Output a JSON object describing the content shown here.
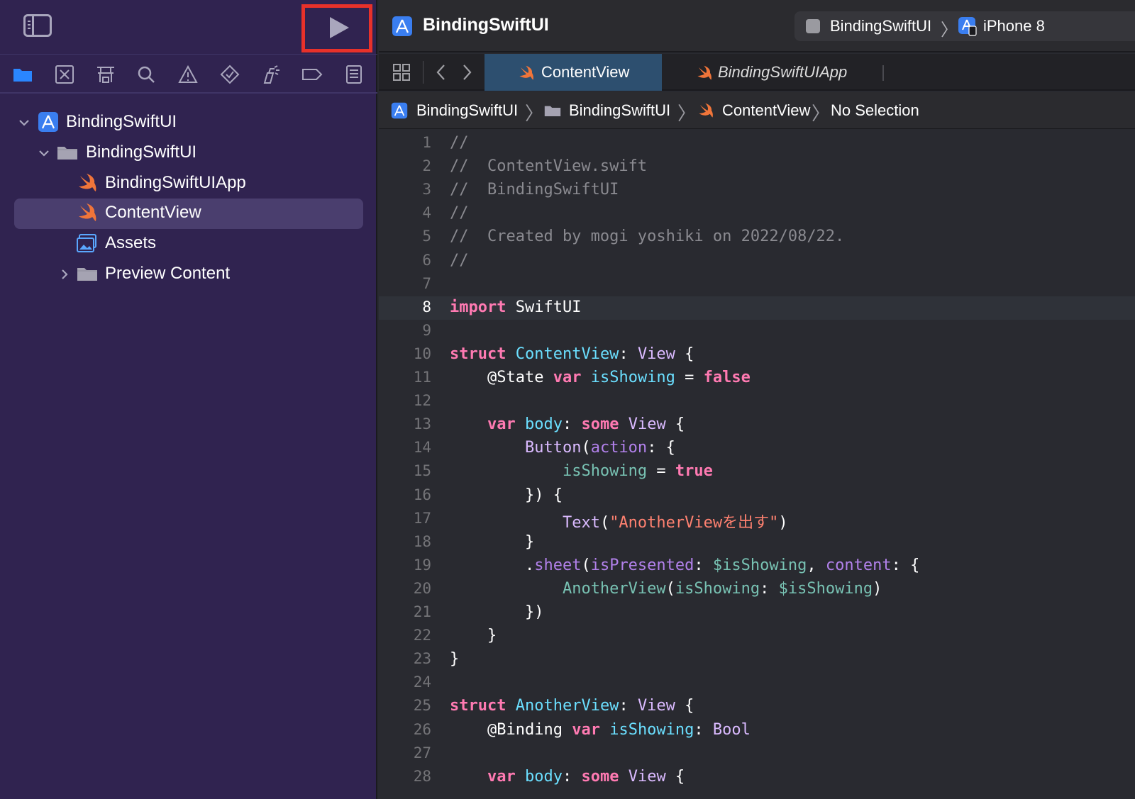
{
  "window": {
    "project_title": "BindingSwiftUI"
  },
  "scheme": {
    "target": "BindingSwiftUI",
    "device": "iPhone 8"
  },
  "tabs": [
    {
      "label": "ContentView",
      "active": true
    },
    {
      "label": "BindingSwiftUIApp",
      "active": false
    }
  ],
  "breadcrumb": [
    "BindingSwiftUI",
    "BindingSwiftUI",
    "ContentView",
    "No Selection"
  ],
  "navigator": {
    "items": [
      {
        "label": "BindingSwiftUI",
        "kind": "project",
        "expanded": true
      },
      {
        "label": "BindingSwiftUI",
        "kind": "folder",
        "expanded": true
      },
      {
        "label": "BindingSwiftUIApp",
        "kind": "swift-file"
      },
      {
        "label": "ContentView",
        "kind": "swift-file",
        "selected": true
      },
      {
        "label": "Assets",
        "kind": "asset-catalog"
      },
      {
        "label": "Preview Content",
        "kind": "folder",
        "expanded": false
      }
    ]
  },
  "editor": {
    "current_line": 8,
    "lines": [
      [
        [
          "//",
          "c-com"
        ]
      ],
      [
        [
          "//  ContentView.swift",
          "c-com"
        ]
      ],
      [
        [
          "//  BindingSwiftUI",
          "c-com"
        ]
      ],
      [
        [
          "//",
          "c-com"
        ]
      ],
      [
        [
          "//  Created by mogi yoshiki on 2022/08/22.",
          "c-com"
        ]
      ],
      [
        [
          "//",
          "c-com"
        ]
      ],
      [],
      [
        [
          "import",
          "c-kw"
        ],
        [
          " SwiftUI",
          "c-plain"
        ]
      ],
      [],
      [
        [
          "struct",
          "c-kw"
        ],
        [
          " ",
          "c-plain"
        ],
        [
          "ContentView",
          "c-type"
        ],
        [
          ": ",
          "c-plain"
        ],
        [
          "View",
          "c-sys"
        ],
        [
          " {",
          "c-plain"
        ]
      ],
      [
        [
          "    ",
          "c-plain"
        ],
        [
          "@State",
          "c-attr"
        ],
        [
          " ",
          "c-plain"
        ],
        [
          "var",
          "c-kw"
        ],
        [
          " ",
          "c-plain"
        ],
        [
          "isShowing",
          "c-type"
        ],
        [
          " = ",
          "c-plain"
        ],
        [
          "false",
          "c-kw"
        ]
      ],
      [],
      [
        [
          "    ",
          "c-plain"
        ],
        [
          "var",
          "c-kw"
        ],
        [
          " ",
          "c-plain"
        ],
        [
          "body",
          "c-type"
        ],
        [
          ": ",
          "c-plain"
        ],
        [
          "some",
          "c-kw"
        ],
        [
          " ",
          "c-plain"
        ],
        [
          "View",
          "c-sys"
        ],
        [
          " {",
          "c-plain"
        ]
      ],
      [
        [
          "        ",
          "c-plain"
        ],
        [
          "Button",
          "c-sys"
        ],
        [
          "(",
          "c-plain"
        ],
        [
          "action",
          "c-par"
        ],
        [
          ": {",
          "c-plain"
        ]
      ],
      [
        [
          "            ",
          "c-plain"
        ],
        [
          "isShowing",
          "c-prop"
        ],
        [
          " = ",
          "c-plain"
        ],
        [
          "true",
          "c-kw"
        ]
      ],
      [
        [
          "        }) {",
          "c-plain"
        ]
      ],
      [
        [
          "            ",
          "c-plain"
        ],
        [
          "Text",
          "c-sys"
        ],
        [
          "(",
          "c-plain"
        ],
        [
          "\"AnotherViewを出す\"",
          "c-str"
        ],
        [
          ")",
          "c-plain"
        ]
      ],
      [
        [
          "        }",
          "c-plain"
        ]
      ],
      [
        [
          "        .",
          "c-plain"
        ],
        [
          "sheet",
          "c-par"
        ],
        [
          "(",
          "c-plain"
        ],
        [
          "isPresented",
          "c-par"
        ],
        [
          ": ",
          "c-plain"
        ],
        [
          "$isShowing",
          "c-prop"
        ],
        [
          ", ",
          "c-plain"
        ],
        [
          "content",
          "c-par"
        ],
        [
          ": {",
          "c-plain"
        ]
      ],
      [
        [
          "            ",
          "c-plain"
        ],
        [
          "AnotherView",
          "c-prop"
        ],
        [
          "(",
          "c-plain"
        ],
        [
          "isShowing",
          "c-prop"
        ],
        [
          ": ",
          "c-plain"
        ],
        [
          "$isShowing",
          "c-prop"
        ],
        [
          ")",
          "c-plain"
        ]
      ],
      [
        [
          "        })",
          "c-plain"
        ]
      ],
      [
        [
          "    }",
          "c-plain"
        ]
      ],
      [
        [
          "}",
          "c-plain"
        ]
      ],
      [],
      [
        [
          "struct",
          "c-kw"
        ],
        [
          " ",
          "c-plain"
        ],
        [
          "AnotherView",
          "c-type"
        ],
        [
          ": ",
          "c-plain"
        ],
        [
          "View",
          "c-sys"
        ],
        [
          " {",
          "c-plain"
        ]
      ],
      [
        [
          "    ",
          "c-plain"
        ],
        [
          "@Binding",
          "c-attr"
        ],
        [
          " ",
          "c-plain"
        ],
        [
          "var",
          "c-kw"
        ],
        [
          " ",
          "c-plain"
        ],
        [
          "isShowing",
          "c-type"
        ],
        [
          ": ",
          "c-plain"
        ],
        [
          "Bool",
          "c-sys"
        ]
      ],
      [],
      [
        [
          "    ",
          "c-plain"
        ],
        [
          "var",
          "c-kw"
        ],
        [
          " ",
          "c-plain"
        ],
        [
          "body",
          "c-type"
        ],
        [
          ": ",
          "c-plain"
        ],
        [
          "some",
          "c-kw"
        ],
        [
          " ",
          "c-plain"
        ],
        [
          "View",
          "c-sys"
        ],
        [
          " {",
          "c-plain"
        ]
      ]
    ]
  }
}
